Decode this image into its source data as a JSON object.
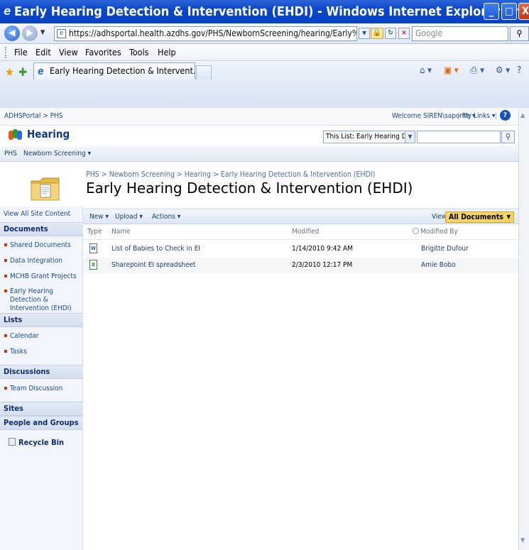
{
  "window": {
    "title": "Early Hearing Detection & Intervention (EHDI) - Windows Internet Explorer pro...",
    "minimize": "_",
    "maximize": "□",
    "close": "X"
  },
  "address_bar": {
    "url": "https://adhsportal.health.azdhs.gov/PHS/NewbornScreening/hearing/Early%",
    "search_placeholder": "Google"
  },
  "menu": [
    "File",
    "Edit",
    "View",
    "Favorites",
    "Tools",
    "Help"
  ],
  "browser_tab": {
    "label": "Early Hearing Detection & Intervent..."
  },
  "portal": {
    "breadcrumb": "ADHSPortal > PHS",
    "welcome": "Welcome SIREN\\saponte ▾",
    "separator1": "|",
    "my_links": "My Links ▾",
    "separator2": "|"
  },
  "site": {
    "title": "Hearing",
    "search_scope": "This List: Early Hearing Detec"
  },
  "top_nav": {
    "items": [
      "PHS",
      "Newborn Screening ▾"
    ]
  },
  "page": {
    "crumbs": "PHS > Newborn Screening > Hearing > Early Hearing Detection & Intervention (EHDI)",
    "title": "Early Hearing Detection & Intervention (EHDI)"
  },
  "left_nav": {
    "view_all": "View All Site Content",
    "documents_header": "Documents",
    "documents": [
      "Shared Documents",
      "Data Integration",
      "MCHB Grant Projects",
      "Early Hearing Detection & Intervention (EHDI)"
    ],
    "lists_header": "Lists",
    "lists": [
      "Calendar",
      "Tasks"
    ],
    "discussions_header": "Discussions",
    "discussions": [
      "Team Discussion"
    ],
    "sites_header": "Sites",
    "people_header": "People and Groups",
    "recycle_bin": "Recycle Bin"
  },
  "toolbar": {
    "new": "New ▾",
    "upload": "Upload ▾",
    "actions": "Actions ▾",
    "view_label": "View:",
    "view_value": "All Documents"
  },
  "columns": {
    "type": "Type",
    "name": "Name",
    "modified": "Modified",
    "modified_by": "Modified By"
  },
  "rows": [
    {
      "icon": "word-doc-icon",
      "name": "List of Babies to Check in EI",
      "modified": "1/14/2010 9:42 AM",
      "modified_by": "Brigitte Dufour"
    },
    {
      "icon": "excel-doc-icon",
      "name": "Sharepoint EI spreadsheet",
      "modified": "2/3/2010 12:17 PM",
      "modified_by": "Amie Bobo"
    }
  ]
}
